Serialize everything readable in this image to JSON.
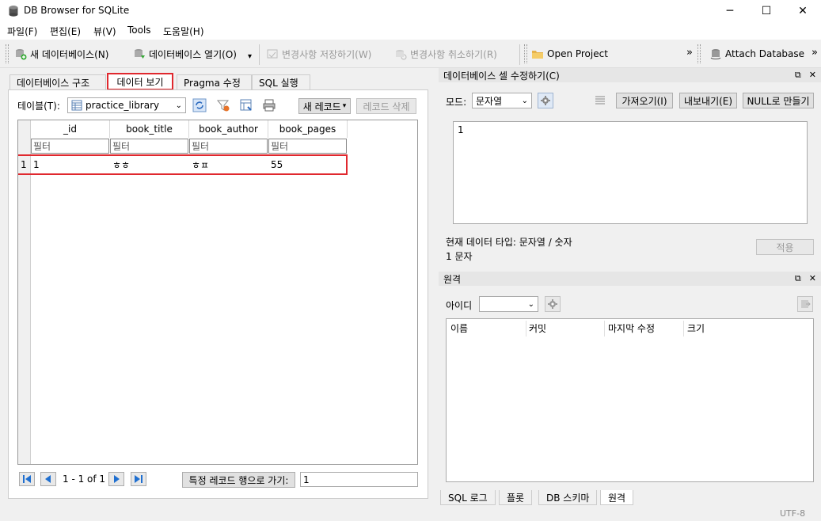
{
  "window": {
    "title": "DB Browser for SQLite",
    "minimize": "─",
    "maximize": "☐",
    "close": "✕"
  },
  "menu": [
    "파일(F)",
    "편집(E)",
    "뷰(V)",
    "Tools",
    "도움말(H)"
  ],
  "toolbar": {
    "new_db": "새 데이터베이스(N)",
    "open_db": "데이터베이스 열기(O)",
    "open_db_arrow": "▾",
    "write_changes": "변경사항 저장하기(W)",
    "revert_changes": "변경사항 취소하기(R)",
    "open_project": "Open Project",
    "overflow": "»",
    "attach_db": "Attach Database",
    "overflow2": "»"
  },
  "tabs": [
    "데이터베이스 구조",
    "데이터 보기",
    "Pragma 수정",
    "SQL 실행"
  ],
  "browse": {
    "table_label": "테이블(T):",
    "table_value": "practice_library",
    "new_record": "새 레코드",
    "new_record_arrow": "▾",
    "delete_record": "레코드 삭제",
    "columns": [
      "_id",
      "book_title",
      "book_author",
      "book_pages"
    ],
    "filter_placeholder": "필터",
    "rows": [
      {
        "num": "1",
        "cells": [
          "1",
          "ㅎㅎ",
          "ㅎㅍ",
          "55"
        ]
      }
    ],
    "pager": "1 - 1 of 1",
    "goto_label": "특정 레코드 행으로 가기:",
    "goto_value": "1"
  },
  "edit_cell": {
    "title": "데이터베이스 셀 수정하기(C)",
    "mode_label": "모드:",
    "mode_value": "문자열",
    "import": "가져오기(I)",
    "export": "내보내기(E)",
    "set_null": "NULL로 만들기",
    "content": "1",
    "type_info": "현재 데이터 타입: 문자열 / 숫자",
    "size_info": "1 문자",
    "apply": "적용",
    "float_icon": "⧉",
    "close_icon": "✕"
  },
  "remote": {
    "title": "원격",
    "id_label": "아이디",
    "columns": [
      "이름",
      "커밋",
      "마지막 수정",
      "크기"
    ]
  },
  "bottom_tabs": [
    "SQL 로그",
    "플롯",
    "DB 스키마",
    "원격"
  ],
  "status": {
    "encoding": "UTF-8"
  },
  "colors": {
    "highlight": "#e0282e",
    "accent_blue": "#1f6fd0"
  }
}
